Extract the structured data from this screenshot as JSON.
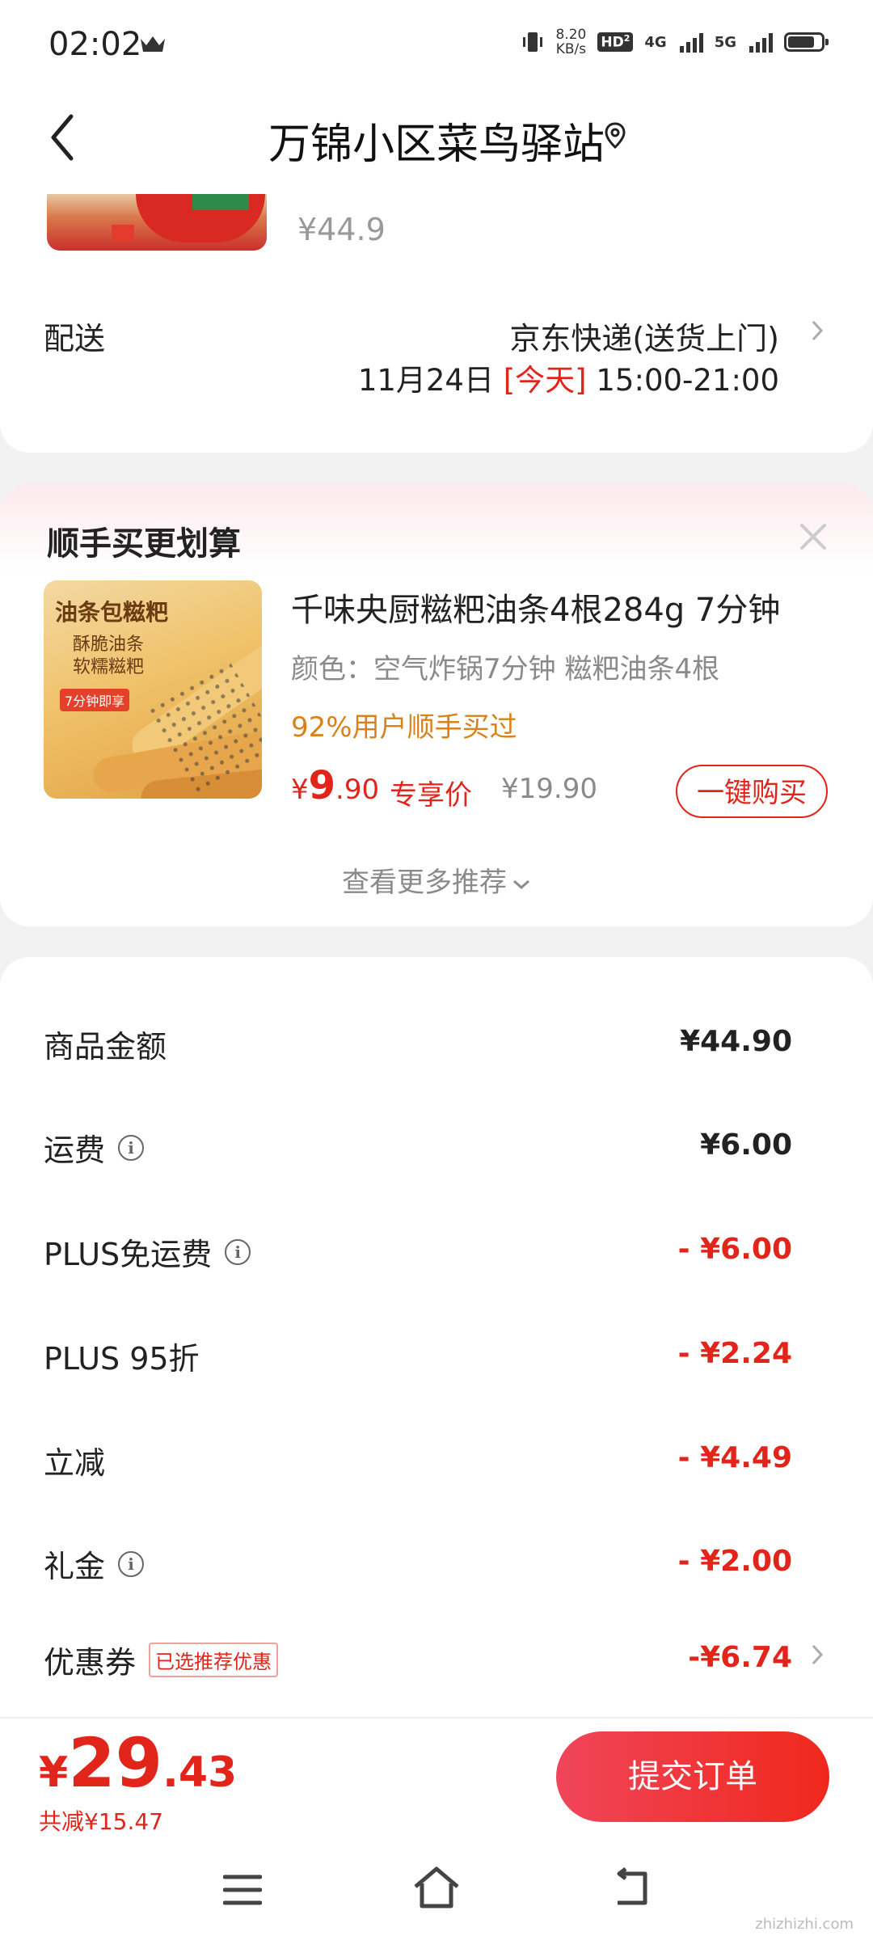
{
  "status_bar": {
    "time": "02:02",
    "net_speed": "8.20",
    "net_unit": "KB/s",
    "hd": "HD",
    "hd2": "2",
    "net1": "4G",
    "net2": "5G"
  },
  "header": {
    "title": "万锦小区菜鸟驿站"
  },
  "order_item": {
    "price": "¥44.9"
  },
  "delivery": {
    "label": "配送",
    "method": "京东快递(送货上门)",
    "date": "11月24日",
    "today": "[今天]",
    "window": "15:00-21:00"
  },
  "recommend": {
    "title": "顺手买更划算",
    "image_text": {
      "line1": "油条包糍粑",
      "line2": "酥脆油条",
      "line3": "软糯糍粑",
      "tag": "7分钟即享"
    },
    "product_name": "千味央厨糍粑油条4根284g 7分钟",
    "attributes": "颜色：空气炸锅7分钟 糍粑油条4根",
    "purchase_rate": "92%用户顺手买过",
    "price_currency": "¥",
    "price_int": "9",
    "price_dec": ".90",
    "vip_label": "专享价",
    "original_price": "¥19.90",
    "buy_button": "一键购买",
    "more_link": "查看更多推荐"
  },
  "price_details": {
    "rows": [
      {
        "label": "商品金额",
        "value": "¥44.90"
      },
      {
        "label": "运费",
        "value": "¥6.00"
      },
      {
        "label": "PLUS免运费",
        "value": "- ¥6.00"
      },
      {
        "label": "PLUS 95折",
        "value": "- ¥2.24"
      },
      {
        "label": "立减",
        "value": "- ¥4.49"
      },
      {
        "label": "礼金",
        "value": "- ¥2.00"
      },
      {
        "label": "优惠券",
        "value": "-¥6.74",
        "tag": "已选推荐优惠"
      }
    ]
  },
  "footer": {
    "currency": "¥",
    "total_int": "29",
    "total_dec": ".43",
    "saved": "共减¥15.47",
    "submit": "提交订单"
  },
  "watermark": "zhizhizhi.com",
  "colors": {
    "accent": "#e1251b",
    "orange": "#d9821b",
    "muted": "#8a8a8a"
  }
}
